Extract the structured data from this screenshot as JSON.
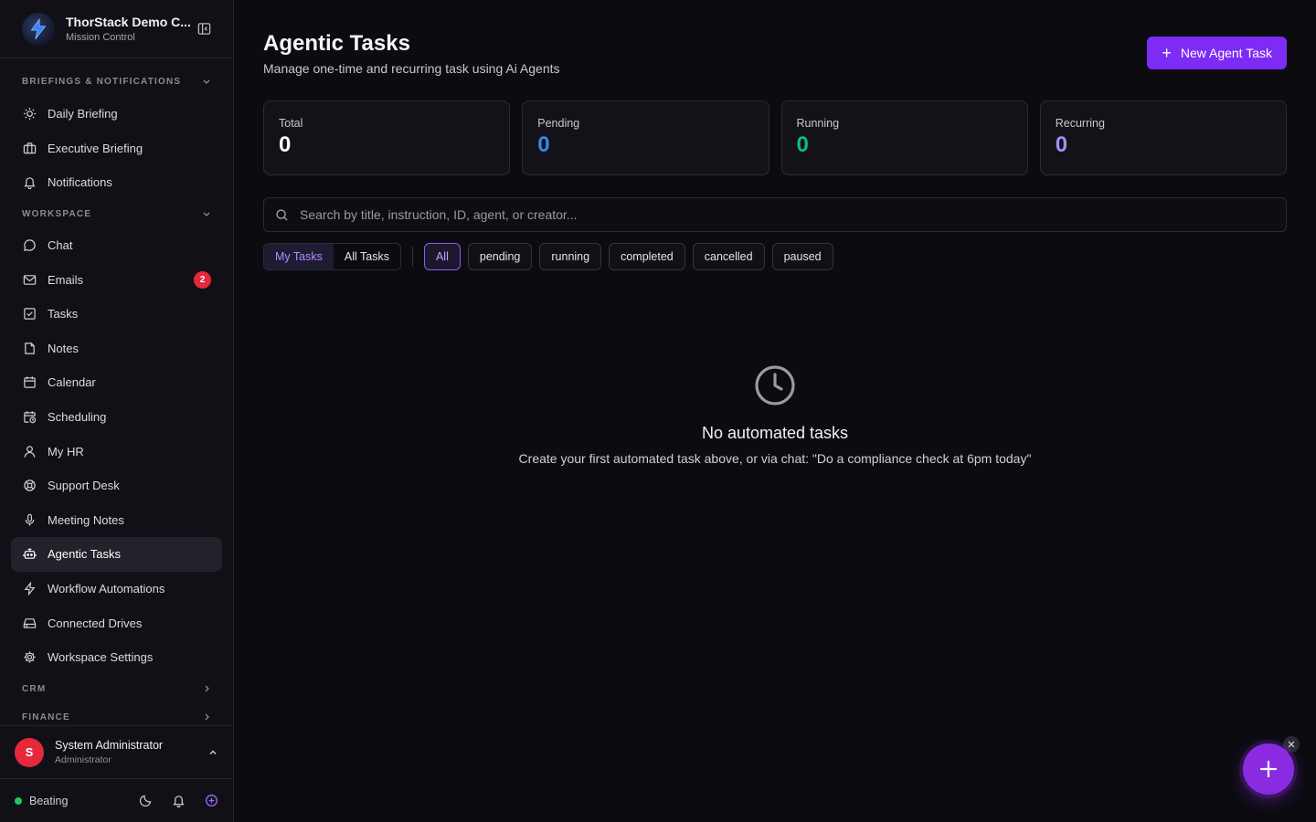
{
  "brand": {
    "title": "ThorStack Demo C...",
    "subtitle": "Mission Control"
  },
  "sidebar": {
    "sections": {
      "briefings": "BRIEFINGS & NOTIFICATIONS",
      "workspace": "WORKSPACE",
      "crm": "CRM",
      "finance": "FINANCE"
    },
    "briefing_items": [
      {
        "label": "Daily Briefing",
        "icon": "sun-icon"
      },
      {
        "label": "Executive Briefing",
        "icon": "briefcase-icon"
      },
      {
        "label": "Notifications",
        "icon": "bell-icon"
      }
    ],
    "workspace_items": [
      {
        "label": "Chat",
        "icon": "chat-icon"
      },
      {
        "label": "Emails",
        "icon": "mail-icon",
        "badge": "2"
      },
      {
        "label": "Tasks",
        "icon": "checkbox-icon"
      },
      {
        "label": "Notes",
        "icon": "note-icon"
      },
      {
        "label": "Calendar",
        "icon": "calendar-icon"
      },
      {
        "label": "Scheduling",
        "icon": "calendar-clock-icon"
      },
      {
        "label": "My HR",
        "icon": "user-icon"
      },
      {
        "label": "Support Desk",
        "icon": "lifebuoy-icon"
      },
      {
        "label": "Meeting Notes",
        "icon": "mic-icon"
      },
      {
        "label": "Agentic Tasks",
        "icon": "bot-icon",
        "active": true
      },
      {
        "label": "Workflow Automations",
        "icon": "bolt-icon"
      },
      {
        "label": "Connected Drives",
        "icon": "drive-icon"
      },
      {
        "label": "Workspace Settings",
        "icon": "gear-icon"
      }
    ]
  },
  "user": {
    "initial": "S",
    "name": "System Administrator",
    "role": "Administrator"
  },
  "footer": {
    "status": "Beating"
  },
  "header": {
    "title": "Agentic Tasks",
    "subtitle": "Manage one-time and recurring task using Ai Agents",
    "new_button": "New Agent Task"
  },
  "stats": [
    {
      "label": "Total",
      "value": "0",
      "color": "#ffffff"
    },
    {
      "label": "Pending",
      "value": "0",
      "color": "#3b82f6"
    },
    {
      "label": "Running",
      "value": "0",
      "color": "#10b981"
    },
    {
      "label": "Recurring",
      "value": "0",
      "color": "#a78bfa"
    }
  ],
  "search": {
    "placeholder": "Search by title, instruction, ID, agent, or creator..."
  },
  "scope_tabs": {
    "mine": "My Tasks",
    "all": "All Tasks"
  },
  "status_filters": [
    "All",
    "pending",
    "running",
    "completed",
    "cancelled",
    "paused"
  ],
  "empty_state": {
    "title": "No automated tasks",
    "subtitle": "Create your first automated task above, or via chat: \"Do a compliance check at 6pm today\""
  },
  "colors": {
    "accent": "#7c2cf5",
    "badge": "#e5283b",
    "status_ok": "#22c55e"
  }
}
